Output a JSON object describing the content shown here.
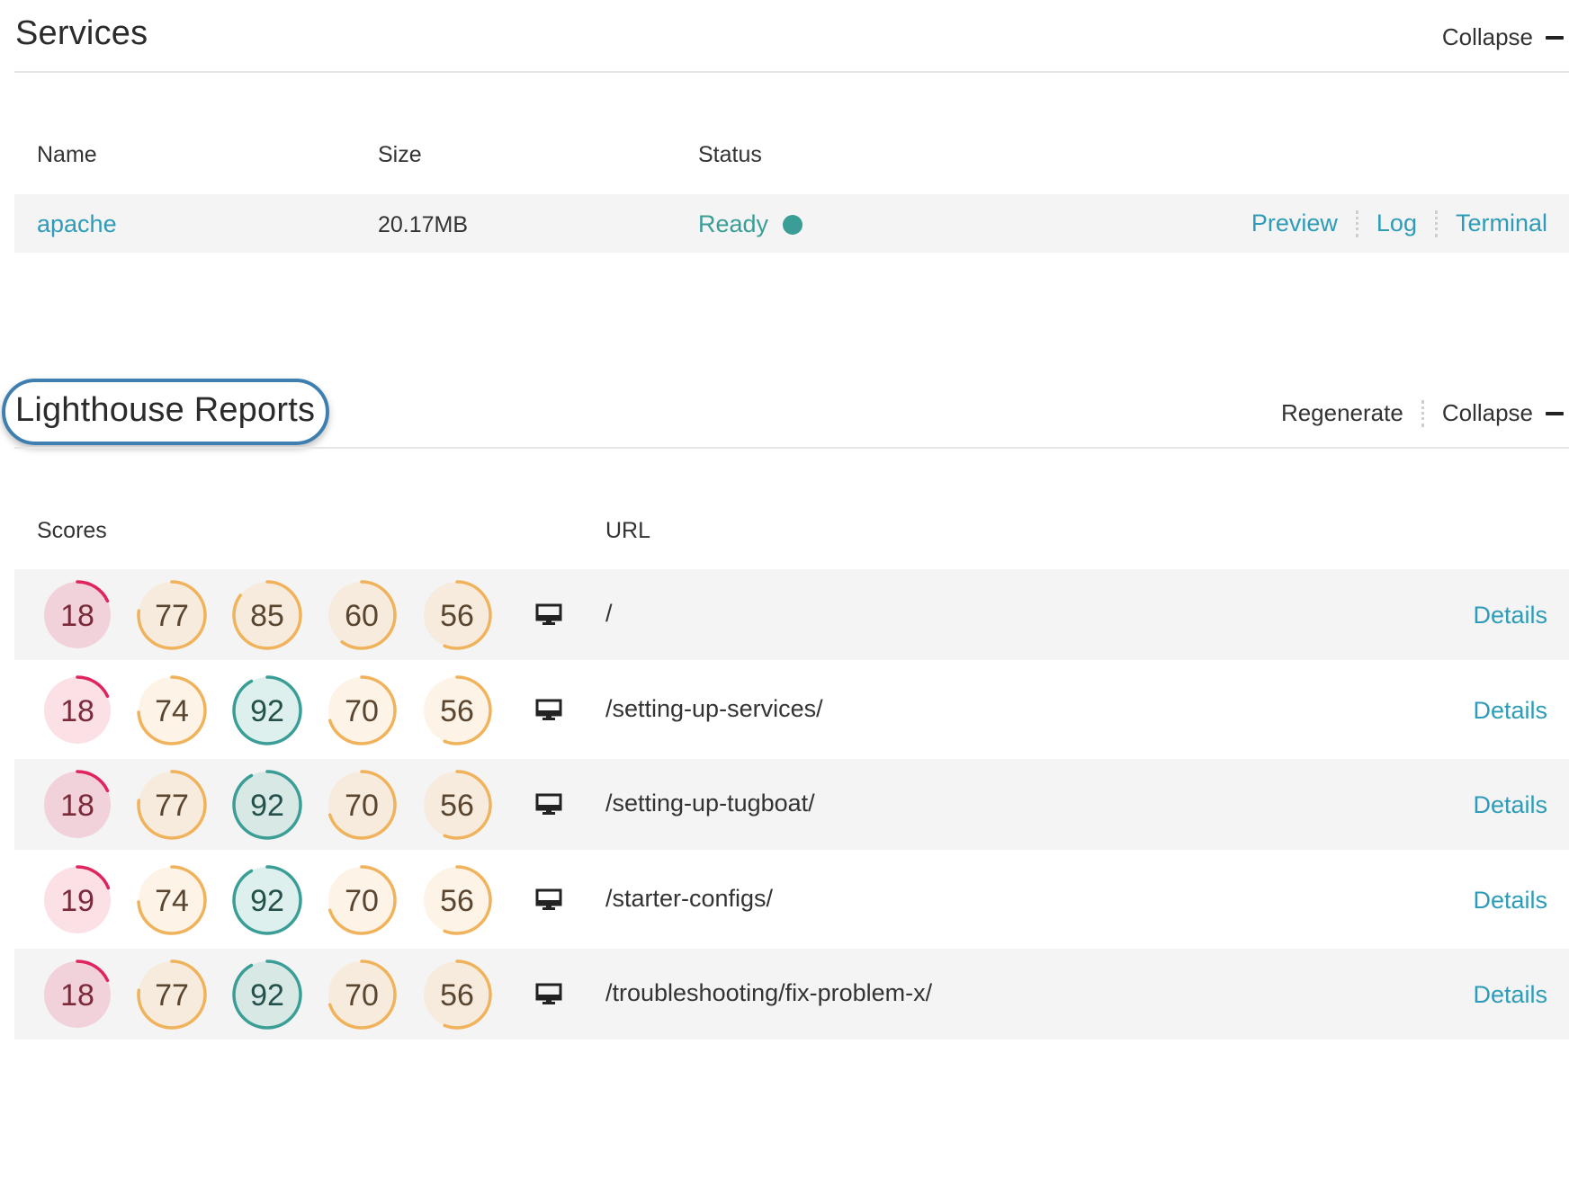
{
  "services": {
    "title": "Services",
    "collapse_label": "Collapse",
    "columns": {
      "name": "Name",
      "size": "Size",
      "status": "Status"
    },
    "row": {
      "name": "apache",
      "size": "20.17MB",
      "status": "Ready",
      "actions": [
        "Preview",
        "Log",
        "Terminal"
      ]
    }
  },
  "lighthouse": {
    "title": "Lighthouse Reports",
    "regenerate_label": "Regenerate",
    "collapse_label": "Collapse",
    "columns": {
      "scores": "Scores",
      "url": "URL"
    },
    "details_label": "Details",
    "device_icon": "desktop-monitor-icon",
    "rows": [
      {
        "scores": [
          18,
          77,
          85,
          60,
          56
        ],
        "url": "/"
      },
      {
        "scores": [
          18,
          74,
          92,
          70,
          56
        ],
        "url": "/setting-up-services/"
      },
      {
        "scores": [
          18,
          77,
          92,
          70,
          56
        ],
        "url": "/setting-up-tugboat/"
      },
      {
        "scores": [
          19,
          74,
          92,
          70,
          56
        ],
        "url": "/starter-configs/"
      },
      {
        "scores": [
          18,
          77,
          92,
          70,
          56
        ],
        "url": "/troubleshooting/fix-problem-x/"
      }
    ]
  },
  "colors": {
    "link": "#2e9cb8",
    "ready": "#3a9e96",
    "score_bad": "#e0245e",
    "score_average": "#f0b25a",
    "score_good": "#3a9e96"
  }
}
